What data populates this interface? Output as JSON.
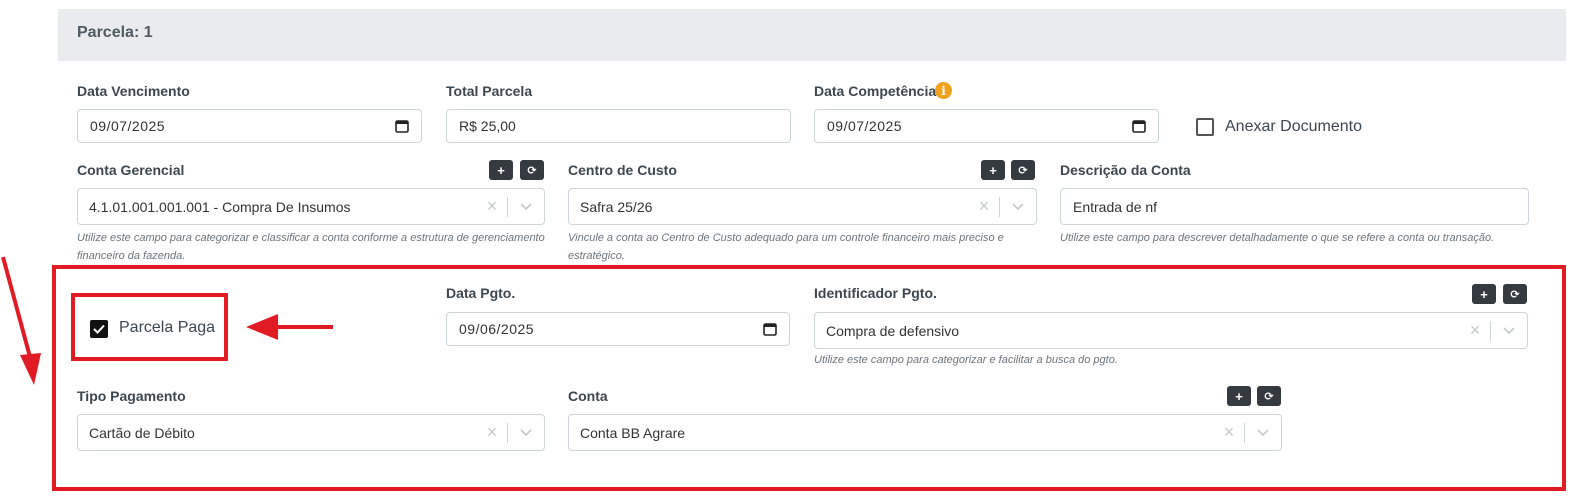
{
  "card": {
    "title": "Parcela: 1"
  },
  "data_vencimento": {
    "label": "Data Vencimento",
    "value": "09/07/2025"
  },
  "total_parcela": {
    "label": "Total Parcela",
    "value": "R$ 25,00"
  },
  "data_competencia": {
    "label": "Data Competência",
    "value": "09/07/2025",
    "info": "i"
  },
  "anexar_documento": {
    "label": "Anexar Documento",
    "checked": false
  },
  "conta_gerencial": {
    "label": "Conta Gerencial",
    "value": "4.1.01.001.001.001 - Compra De Insumos",
    "help": "Utilize este campo para categorizar e classificar a conta conforme a estrutura de gerenciamento financeiro da fazenda."
  },
  "centro_custo": {
    "label": "Centro de Custo",
    "value": "Safra 25/26",
    "help": "Vincule a conta ao Centro de Custo adequado para um controle financeiro mais preciso e estratégico."
  },
  "descricao_conta": {
    "label": "Descrição da Conta",
    "value": "Entrada de nf",
    "help": "Utilize este campo para descrever detalhadamente o que se refere a conta ou transação."
  },
  "parcela_paga": {
    "label": "Parcela Paga",
    "checked": true
  },
  "data_pgto": {
    "label": "Data Pgto.",
    "value": "09/06/2025"
  },
  "identificador_pgto": {
    "label": "Identificador Pgto.",
    "value": "Compra de defensivo",
    "help": "Utilize este campo para categorizar e facilitar a busca do pgto."
  },
  "tipo_pagamento": {
    "label": "Tipo Pagamento",
    "value": "Cartão de Débito"
  },
  "conta": {
    "label": "Conta",
    "value": "Conta BB Agrare"
  },
  "buttons": {
    "add": "+",
    "refresh": "⟳",
    "clear": "×"
  },
  "colors": {
    "annotation_red": "#e01b24",
    "header_bg": "#e9ebee",
    "dark_button": "#343a40",
    "info_orange": "#f0a21b"
  }
}
